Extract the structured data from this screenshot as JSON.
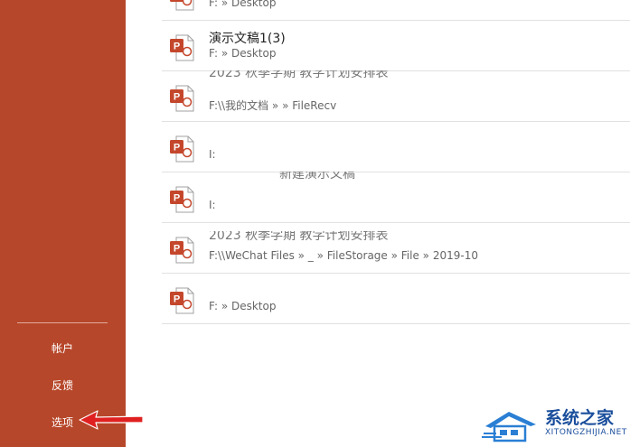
{
  "sidebar": {
    "items": [
      {
        "label": "帐户"
      },
      {
        "label": "反馈"
      },
      {
        "label": "选项"
      }
    ]
  },
  "recent_files": [
    {
      "name": "",
      "path": "F: » Desktop"
    },
    {
      "name": "演示文稿1(3)",
      "path": "F: » Desktop"
    },
    {
      "name": "",
      "path": "F:\\\\我的文档 »                  » FileRecv",
      "name_partial": "2023 秋季学期 教学计划安排表"
    },
    {
      "name": "",
      "path": "I:"
    },
    {
      "name": "",
      "path": "I:",
      "name_partial": "新建演示文稿"
    },
    {
      "name": "",
      "path": "F:\\\\WeChat Files »           _ » FileStorage » File » 2019-10",
      "name_partial": "2023 秋季学期 教学计划安排表"
    },
    {
      "name": "",
      "path": "F: » Desktop"
    }
  ],
  "watermark": {
    "title": "系统之家",
    "subtitle": "XITONGZHIJIA.NET"
  },
  "colors": {
    "sidebar": "#b7472a",
    "ppt_icon": "#c4472c",
    "arrow": "#e02020",
    "watermark": "#1a4e9c"
  }
}
